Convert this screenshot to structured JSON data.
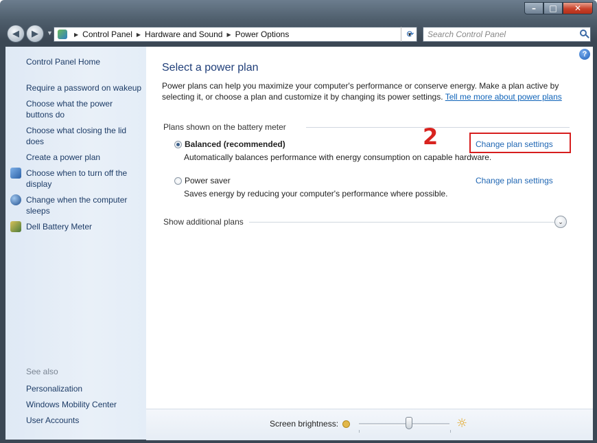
{
  "window": {
    "title_buttons": [
      "–",
      "□",
      "✕"
    ]
  },
  "nav": {
    "back_glyph": "◀",
    "forward_glyph": "▶",
    "breadcrumb": [
      "Control Panel",
      "Hardware and Sound",
      "Power Options"
    ],
    "refresh_glyph": "⟳",
    "search_placeholder": "Search Control Panel"
  },
  "sidebar": {
    "home": "Control Panel Home",
    "links": [
      {
        "label": "Require a password on wakeup",
        "icon": null
      },
      {
        "label": "Choose what the power buttons do",
        "icon": null
      },
      {
        "label": "Choose what closing the lid does",
        "icon": null
      },
      {
        "label": "Create a power plan",
        "icon": null
      },
      {
        "label": "Choose when to turn off the display",
        "icon": "display-shield-icon"
      },
      {
        "label": "Change when the computer sleeps",
        "icon": "moon-shield-icon"
      },
      {
        "label": "Dell Battery Meter",
        "icon": "battery-meter-icon"
      }
    ],
    "see_also_header": "See also",
    "see_also": [
      "Personalization",
      "Windows Mobility Center",
      "User Accounts"
    ]
  },
  "main": {
    "title": "Select a power plan",
    "intro_text": "Power plans can help you maximize your computer's performance or conserve energy. Make a plan active by selecting it, or choose a plan and customize it by changing its power settings.",
    "intro_link": "Tell me more about power plans",
    "group_header": "Plans shown on the battery meter",
    "plans": [
      {
        "name": "Balanced (recommended)",
        "description": "Automatically balances performance with energy consumption on capable hardware.",
        "link": "Change plan settings",
        "selected": true
      },
      {
        "name": "Power saver",
        "description": "Saves energy by reducing your computer's performance where possible.",
        "link": "Change plan settings",
        "selected": false
      }
    ],
    "annotation_number": "2",
    "show_additional": "Show additional plans"
  },
  "bottom": {
    "brightness_label": "Screen brightness:",
    "brightness_level_pct": 55
  },
  "colors": {
    "accent_link": "#1f66b3",
    "title_blue": "#1e3d78",
    "annotation_red": "#d61d1d"
  }
}
